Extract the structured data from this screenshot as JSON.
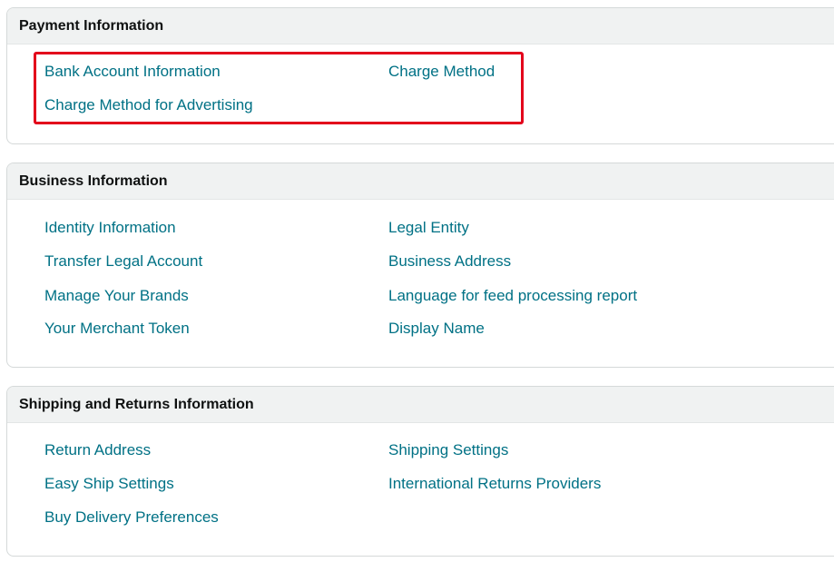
{
  "sections": [
    {
      "title": "Payment Information",
      "links": [
        "Bank Account Information",
        "Charge Method",
        "Charge Method for Advertising"
      ]
    },
    {
      "title": "Business Information",
      "links": [
        "Identity Information",
        "Legal Entity",
        "Transfer Legal Account",
        "Business Address",
        "Manage Your Brands",
        "Language for feed processing report",
        "Your Merchant Token",
        "Display Name"
      ]
    },
    {
      "title": "Shipping and Returns Information",
      "links": [
        "Return Address",
        "Shipping Settings",
        "Easy Ship Settings",
        "International Returns Providers",
        "Buy Delivery Preferences"
      ]
    }
  ],
  "colors": {
    "link": "#007185",
    "header_bg": "#f0f2f2",
    "border": "#d5d9d9",
    "highlight": "#e3001b"
  }
}
